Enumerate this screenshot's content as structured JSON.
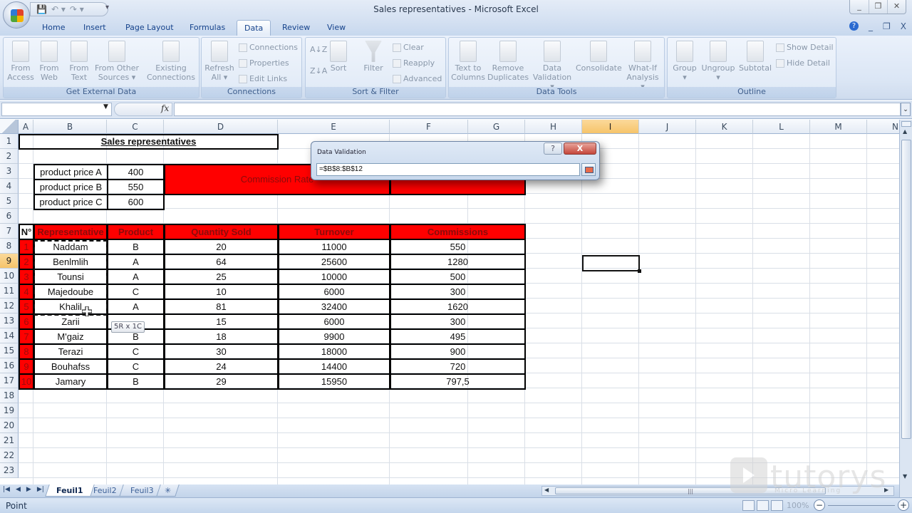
{
  "window": {
    "title": "Sales representatives - Microsoft Excel",
    "controls": [
      "_",
      "❐",
      "✕"
    ]
  },
  "qat": {
    "save": "💾",
    "undo": "↶ ▾",
    "redo": "↷ ▾",
    "more": "₹"
  },
  "tabs": [
    "Home",
    "Insert",
    "Page Layout",
    "Formulas",
    "Data",
    "Review",
    "View"
  ],
  "active_tab": "Data",
  "ribbon_right": {
    "help": "?",
    "min": "_",
    "restore": "❐",
    "close": "X"
  },
  "ribbon": {
    "groups": [
      {
        "label": "Get External Data",
        "buttons": [
          {
            "l1": "From",
            "l2": "Access"
          },
          {
            "l1": "From",
            "l2": "Web"
          },
          {
            "l1": "From",
            "l2": "Text"
          },
          {
            "l1": "From Other",
            "l2": "Sources ▾"
          },
          {
            "l1": "Existing",
            "l2": "Connections"
          }
        ]
      },
      {
        "label": "Connections",
        "buttons": [
          {
            "l1": "Refresh",
            "l2": "All ▾"
          }
        ],
        "small": [
          "Connections",
          "Properties",
          "Edit Links"
        ]
      },
      {
        "label": "Sort & Filter",
        "buttons": [
          {
            "l1": "Sort",
            "l2": ""
          },
          {
            "l1": "Filter",
            "l2": ""
          }
        ],
        "small": [
          "Clear",
          "Reapply",
          "Advanced"
        ],
        "sort_az": "A↓Z",
        "sort_za": "Z↓A"
      },
      {
        "label": "Data Tools",
        "buttons": [
          {
            "l1": "Text to",
            "l2": "Columns"
          },
          {
            "l1": "Remove",
            "l2": "Duplicates"
          },
          {
            "l1": "Data",
            "l2": "Validation ▾"
          },
          {
            "l1": "Consolidate",
            "l2": ""
          },
          {
            "l1": "What-If",
            "l2": "Analysis ▾"
          }
        ]
      },
      {
        "label": "Outline",
        "buttons": [
          {
            "l1": "Group",
            "l2": "▾"
          },
          {
            "l1": "Ungroup",
            "l2": "▾"
          },
          {
            "l1": "Subtotal",
            "l2": ""
          }
        ],
        "small": [
          "Show Detail",
          "Hide Detail"
        ]
      }
    ]
  },
  "formula_bar": {
    "name_box": "",
    "fx": "fx",
    "formula": ""
  },
  "columns": [
    "A",
    "B",
    "C",
    "D",
    "E",
    "F",
    "G",
    "H",
    "I",
    "J",
    "K",
    "L",
    "M",
    "N"
  ],
  "selected_column": "I",
  "rows": [
    "1",
    "2",
    "3",
    "4",
    "5",
    "6",
    "7",
    "8",
    "9",
    "10",
    "11",
    "12",
    "13",
    "14",
    "15",
    "16",
    "17",
    "18",
    "19",
    "20",
    "21",
    "22",
    "23"
  ],
  "selected_row": "9",
  "sheet": {
    "title": "Sales representatives",
    "prices": [
      {
        "label": "product price A",
        "value": "400"
      },
      {
        "label": "product price B",
        "value": "550"
      },
      {
        "label": "product price C",
        "value": "600"
      }
    ],
    "commission_rate_label": "Commission Rate",
    "commission_rate_value": "",
    "table_headers": [
      "N°",
      "Representative",
      "Product",
      "Quantity Sold",
      "Turnover",
      "Commissions"
    ],
    "table_rows": [
      [
        "1",
        "Naddam",
        "B",
        "20",
        "11000",
        "550"
      ],
      [
        "2",
        "Benlmlih",
        "A",
        "64",
        "25600",
        "1280"
      ],
      [
        "3",
        "Tounsi",
        "A",
        "25",
        "10000",
        "500"
      ],
      [
        "4",
        "Majedoube",
        "C",
        "10",
        "6000",
        "300"
      ],
      [
        "5",
        "Khalil",
        "A",
        "81",
        "32400",
        "1620"
      ],
      [
        "6",
        "Zarii",
        "",
        "15",
        "6000",
        "300"
      ],
      [
        "7",
        "M'gaiz",
        "B",
        "18",
        "9900",
        "495"
      ],
      [
        "8",
        "Terazi",
        "C",
        "30",
        "18000",
        "900"
      ],
      [
        "9",
        "Bouhafss",
        "C",
        "24",
        "14400",
        "720"
      ],
      [
        "10",
        "Jamary",
        "B",
        "29",
        "15950",
        "797,5"
      ]
    ],
    "selection_tooltip": "5R x 1C"
  },
  "dialog": {
    "title": "Data Validation",
    "input": "=$B$8:$B$12",
    "help": "?",
    "close": "X"
  },
  "sheet_tabs": [
    "Feuil1",
    "Feuil2",
    "Feuil3"
  ],
  "active_sheet": "Feuil1",
  "sheet_nav": [
    "|◀",
    "◀",
    "▶",
    "▶|"
  ],
  "status": {
    "mode": "Point",
    "zoom": "100%",
    "minus": "−",
    "plus": "+"
  },
  "watermark": {
    "brand": "tutorys",
    "sub": "Micro Learning"
  },
  "colors": {
    "accent_red": "#ff0000",
    "header_text": "#8a0b0b",
    "selection_orange": "#f6c46a"
  }
}
